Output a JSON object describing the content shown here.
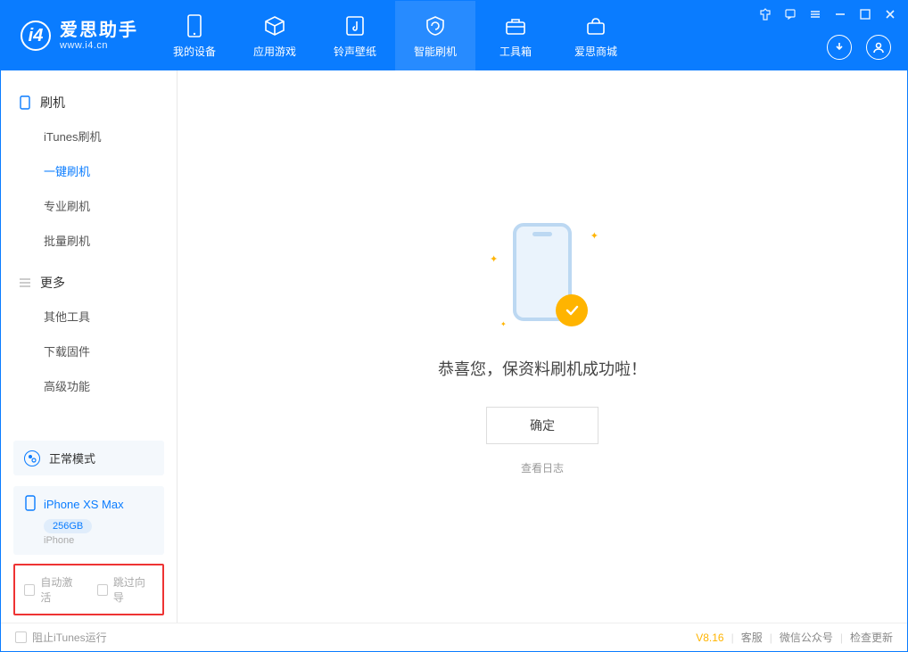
{
  "app": {
    "name": "爱思助手",
    "url": "www.i4.cn"
  },
  "nav": {
    "items": [
      {
        "label": "我的设备",
        "icon": "device-icon"
      },
      {
        "label": "应用游戏",
        "icon": "cube-icon"
      },
      {
        "label": "铃声壁纸",
        "icon": "music-icon"
      },
      {
        "label": "智能刷机",
        "icon": "refresh-icon"
      },
      {
        "label": "工具箱",
        "icon": "toolbox-icon"
      },
      {
        "label": "爱思商城",
        "icon": "store-icon"
      }
    ],
    "active_index": 3
  },
  "sidebar": {
    "group1": {
      "title": "刷机",
      "items": [
        "iTunes刷机",
        "一键刷机",
        "专业刷机",
        "批量刷机"
      ],
      "active_index": 1
    },
    "group2": {
      "title": "更多",
      "items": [
        "其他工具",
        "下载固件",
        "高级功能"
      ]
    },
    "mode_card": {
      "label": "正常模式"
    },
    "device_card": {
      "name": "iPhone XS Max",
      "storage": "256GB",
      "type": "iPhone"
    },
    "options": {
      "auto_activate": "自动激活",
      "skip_guide": "跳过向导"
    }
  },
  "content": {
    "success_message": "恭喜您，保资料刷机成功啦！",
    "ok_button": "确定",
    "view_log": "查看日志"
  },
  "footer": {
    "block_itunes": "阻止iTunes运行",
    "version": "V8.16",
    "links": [
      "客服",
      "微信公众号",
      "检查更新"
    ]
  }
}
